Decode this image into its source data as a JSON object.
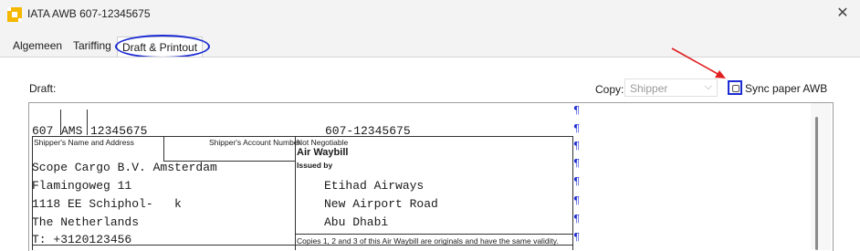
{
  "window": {
    "title": "IATA AWB 607-12345675",
    "icon": "app-logo-icon",
    "close_glyph": "✕"
  },
  "tabs": [
    {
      "label": "Algemeen",
      "active": false
    },
    {
      "label": "Tariffing",
      "active": false
    },
    {
      "label": "Draft & Printout",
      "active": true
    }
  ],
  "draft": {
    "label": "Draft:",
    "copy_label": "Copy:",
    "copy_value": "Shipper",
    "sync_label": "Sync paper AWB",
    "sync_checked": false
  },
  "awb": {
    "line1_prefix": "607",
    "line1_airport": "AMS",
    "line1_serial": "12345675",
    "line1_right": "607-12345675",
    "shipper_name_hdr": "Shipper's Name and Address",
    "shipper_account_hdr": "Shipper's Account Number",
    "not_negotiable": "Not Negotiable",
    "air_waybill": "Air Waybill",
    "issued_by": "Issued by",
    "shipper_lines": [
      "Scope Cargo B.V. Amsterdam",
      "Flamingoweg 11",
      "1118 EE Schiphol-   k",
      "The Netherlands",
      "T: +3120123456"
    ],
    "issuer_lines": [
      "Etihad Airways",
      "New Airport Road",
      "Abu Dhabi"
    ],
    "copies_note": "Copies 1, 2 and 3 of this Air Waybill are originals and have the same validity.",
    "pilcrow": "¶"
  },
  "colors": {
    "annotation_blue": "#1c2bd3",
    "annotation_red": "#e02020"
  }
}
